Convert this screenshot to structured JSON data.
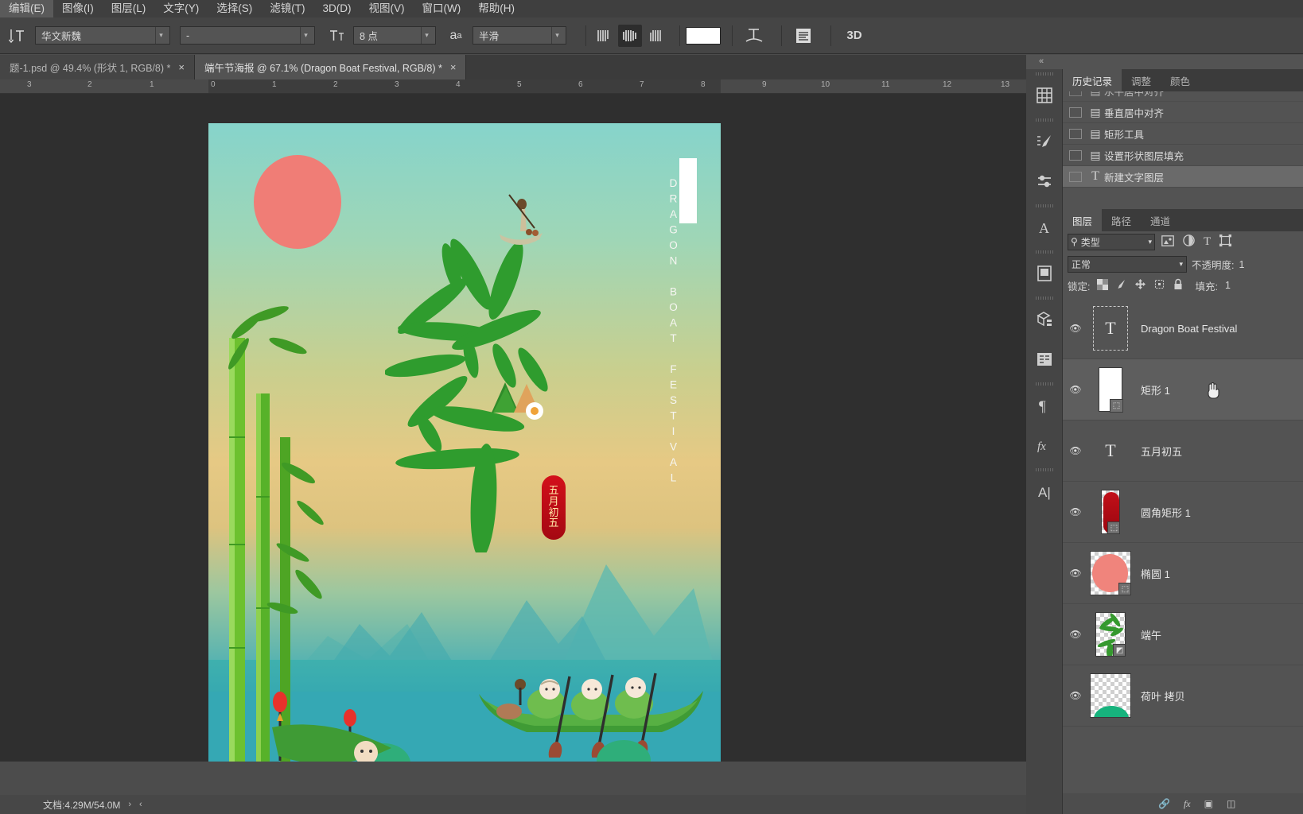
{
  "menubar": {
    "items": [
      {
        "label": "编辑(E)"
      },
      {
        "label": "图像(I)"
      },
      {
        "label": "图层(L)"
      },
      {
        "label": "文字(Y)"
      },
      {
        "label": "选择(S)"
      },
      {
        "label": "滤镜(T)"
      },
      {
        "label": "3D(D)"
      },
      {
        "label": "视图(V)"
      },
      {
        "label": "窗口(W)"
      },
      {
        "label": "帮助(H)"
      }
    ]
  },
  "options_bar": {
    "tool_icon": "text-orientation-icon",
    "font_family": "华文新魏",
    "font_style": "-",
    "font_size": "8 点",
    "antialias_icon": "aa-icon",
    "antialias": "半滑",
    "align": [
      "align-left-icon",
      "align-center-icon",
      "align-right-icon"
    ],
    "align_active_index": 1,
    "color": "#ffffff",
    "warp_icon": "warp-text-icon",
    "panel_icon": "character-panel-icon",
    "threed_label": "3D"
  },
  "tabs": [
    {
      "title": "题-1.psd @ 49.4% (形状 1, RGB/8) *",
      "active": false,
      "close": "×"
    },
    {
      "title": "端午节海报 @ 67.1% (Dragon Boat Festival, RGB/8) *",
      "active": true,
      "close": "×"
    }
  ],
  "ruler": {
    "labels": [
      "3",
      "2",
      "1",
      "0",
      "1",
      "2",
      "3",
      "4",
      "5",
      "6",
      "7",
      "8",
      "9",
      "10",
      "11",
      "12",
      "13"
    ]
  },
  "canvas": {
    "poster": {
      "vertical_english": "DRAGON BOAT FESTIVAL",
      "seal_text": [
        "五",
        "月",
        "初",
        "五"
      ],
      "title_chars": [
        "端",
        "午"
      ]
    }
  },
  "statusbar": {
    "doc_info": "文档:4.29M/54.0M",
    "next_arrow": "›",
    "prev_arrow": "‹"
  },
  "dock": {
    "collapse_icon": "collapse-panels-icon",
    "rail_icons": [
      {
        "name": "grid-icon"
      },
      {
        "name": "brush-preset-icon"
      },
      {
        "name": "adjustments-icon"
      },
      {
        "name": "glyphs-icon"
      },
      {
        "name": "library-icon"
      },
      {
        "name": "3d-icon"
      },
      {
        "name": "properties-icon"
      },
      {
        "name": "paragraph-icon"
      },
      {
        "name": "fx-icon"
      },
      {
        "name": "character-icon"
      }
    ],
    "history_panel": {
      "tabs": [
        {
          "label": "历史记录",
          "active": true
        },
        {
          "label": "调整",
          "active": false
        },
        {
          "label": "颜色",
          "active": false
        }
      ],
      "items": [
        {
          "label": "水平居中对齐",
          "icon": "history-state-icon",
          "active": false,
          "partial": true
        },
        {
          "label": "垂直居中对齐",
          "icon": "history-state-icon",
          "active": false
        },
        {
          "label": "矩形工具",
          "icon": "history-state-icon",
          "active": false
        },
        {
          "label": "设置形状图层填充",
          "icon": "history-state-icon",
          "active": false
        },
        {
          "label": "新建文字图层",
          "icon": "type-state-icon",
          "active": true
        }
      ]
    },
    "layers_panel": {
      "tabs": [
        {
          "label": "图层",
          "active": true
        },
        {
          "label": "路径",
          "active": false
        },
        {
          "label": "通道",
          "active": false
        }
      ],
      "filter_label": "类型",
      "filter_icons": [
        "image-filter-icon",
        "adjustment-filter-icon",
        "type-filter-icon",
        "shape-filter-icon"
      ],
      "blend_mode": "正常",
      "opacity_label": "不透明度:",
      "opacity_value": "1",
      "lock_label": "锁定:",
      "lock_icons": [
        "lock-transparency-icon",
        "lock-image-icon",
        "lock-position-icon",
        "lock-artboard-icon",
        "lock-all-icon"
      ],
      "fill_label": "填充:",
      "fill_value": "1",
      "layers": [
        {
          "name": "Dragon Boat Festival",
          "type": "text",
          "visible": true,
          "selected": false,
          "thumb": "text"
        },
        {
          "name": "矩形 1",
          "type": "shape",
          "visible": true,
          "selected": true,
          "thumb": "white-rect"
        },
        {
          "name": "五月初五",
          "type": "text",
          "visible": true,
          "selected": false,
          "thumb": "text-plain"
        },
        {
          "name": "圆角矩形 1",
          "type": "shape",
          "visible": true,
          "selected": false,
          "thumb": "red-rounded"
        },
        {
          "name": "椭圆 1",
          "type": "shape",
          "visible": true,
          "selected": false,
          "thumb": "pink-ellipse"
        },
        {
          "name": "端午",
          "type": "smart",
          "visible": true,
          "selected": false,
          "thumb": "leaf-chars"
        },
        {
          "name": "荷叶 拷贝",
          "type": "raster",
          "visible": true,
          "selected": false,
          "thumb": "green-leaf"
        }
      ],
      "footer_icons": [
        "link-icon",
        "fx-icon",
        "mask-icon",
        "group-icon"
      ]
    }
  }
}
